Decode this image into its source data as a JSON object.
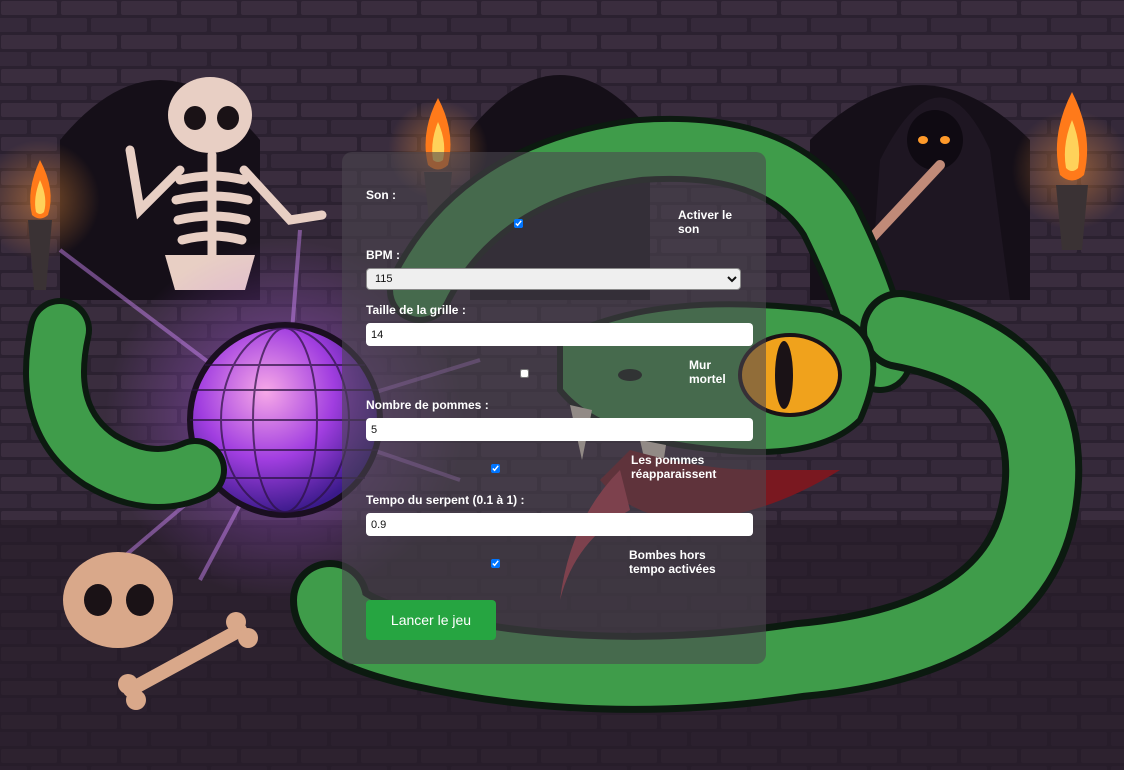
{
  "form": {
    "sound_label": "Son :",
    "sound_toggle_label": "Activer le son",
    "sound_enabled": true,
    "bpm_label": "BPM :",
    "bpm_selected": "115",
    "grid_size_label": "Taille de la grille :",
    "grid_size_value": "14",
    "deadly_wall_label": "Mur mortel",
    "deadly_wall_enabled": false,
    "apples_label": "Nombre de pommes :",
    "apples_value": "5",
    "apples_respawn_label": "Les pommes réapparaissent",
    "apples_respawn_enabled": true,
    "snake_tempo_label": "Tempo du serpent (0.1 à 1) :",
    "snake_tempo_value": "0.9",
    "off_tempo_bombs_label": "Bombes hors tempo activées",
    "off_tempo_bombs_enabled": true,
    "start_button_label": "Lancer le jeu"
  },
  "colors": {
    "start_button": "#26a541",
    "snake": "#3f9c4a",
    "background": "#2a1e2c",
    "panel": "rgba(75,70,80,0.58)"
  }
}
